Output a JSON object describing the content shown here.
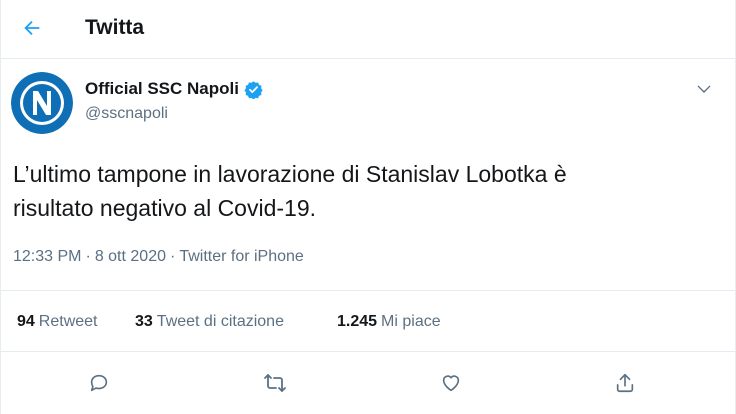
{
  "header": {
    "back_icon": "arrow-left-icon",
    "title": "Twitta"
  },
  "tweet": {
    "author": {
      "name": "Official SSC Napoli",
      "handle": "@sscnapoli",
      "verified_icon": "verified-badge-icon",
      "avatar_letter": "N",
      "avatar_color": "#0e6fb6"
    },
    "menu_icon": "chevron-down-icon",
    "text_line1": "L’ultimo tampone in lavorazione di Stanislav Lobotka è",
    "text_line2": "risultato negativo al Covid-19.",
    "time": "12:33 PM",
    "date": "8 ott 2020",
    "source": "Twitter for iPhone",
    "separator": "·"
  },
  "stats": {
    "retweets_count": "94",
    "retweets_label": "Retweet",
    "quotes_count": "33",
    "quotes_label": "Tweet di citazione",
    "likes_count": "1.245",
    "likes_label": "Mi piace"
  },
  "actions": {
    "reply_icon": "reply-icon",
    "retweet_icon": "retweet-icon",
    "like_icon": "heart-icon",
    "share_icon": "share-icon"
  },
  "colors": {
    "accent": "#1da1f2",
    "text_primary": "#14171a",
    "text_secondary": "#5b7083",
    "border": "#e6ecf0"
  }
}
